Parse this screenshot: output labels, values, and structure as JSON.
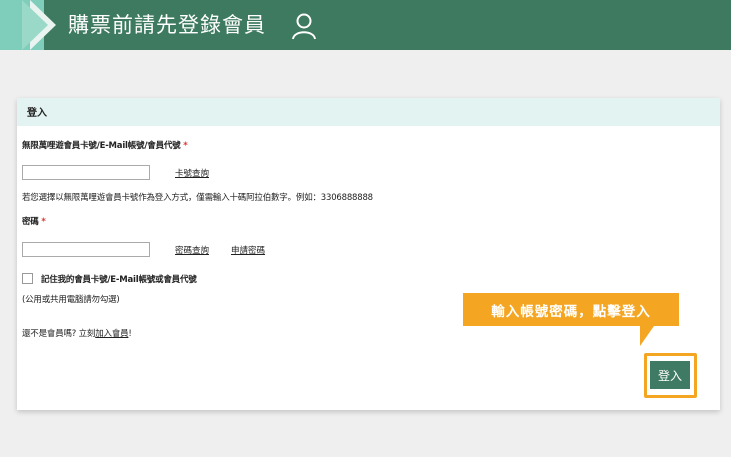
{
  "header": {
    "title": "購票前請先登錄會員",
    "icon": "user-icon",
    "bg_color": "#3d7a5f"
  },
  "login": {
    "section_title": "登入",
    "account_label": "無限萬哩遊會員卡號/E-Mail帳號/會員代號",
    "required_mark": "*",
    "account_value": "",
    "card_lookup_link": "卡號查詢",
    "hint": "若您選擇以無限萬哩遊會員卡號作為登入方式，僅需輸入十碼阿拉伯數字。例如：3306888888",
    "password_label": "密碼",
    "password_value": "",
    "password_lookup_link": "密碼查詢",
    "password_apply_link": "申請密碼",
    "remember_label": "記住我的會員卡號/E-Mail帳號或會員代號",
    "remember_checked": false,
    "remember_note": "(公用或共用電腦請勿勾選)",
    "not_member_text": "還不是會員嗎? 立刻",
    "join_link": "加入會員",
    "join_suffix": "!",
    "login_button": "登入"
  },
  "callout": {
    "text": "輸入帳號密碼，點擊登入",
    "color": "#f4a623"
  }
}
